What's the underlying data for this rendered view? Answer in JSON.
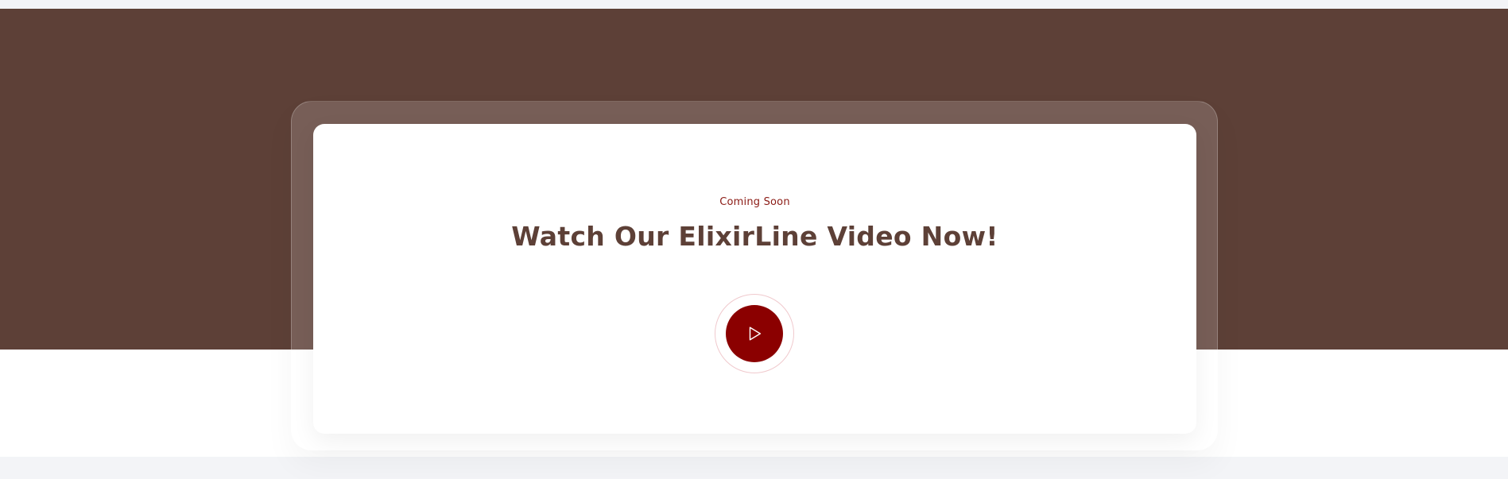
{
  "section": {
    "eyebrow": "Coming Soon",
    "title": "Watch Our ElixirLine Video Now!"
  },
  "play_button": {
    "icon": "play-icon"
  },
  "colors": {
    "hero_background": "#5d4037",
    "eyebrow_text": "#8b1a14",
    "title_text": "#5d4037",
    "play_button": "#8b0000",
    "page_background": "#f3f4f7"
  }
}
